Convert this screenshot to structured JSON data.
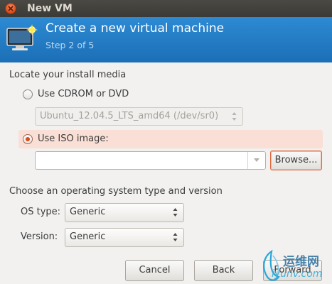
{
  "window": {
    "title": "New VM"
  },
  "header": {
    "title": "Create a new virtual machine",
    "step": "Step 2 of 5"
  },
  "install_media": {
    "heading": "Locate your install media",
    "cdrom_label": "Use CDROM or DVD",
    "cdrom_selected_device": "Ubuntu_12.04.5_LTS_amd64 (/dev/sr0)",
    "iso_label": "Use ISO image:",
    "iso_path": "",
    "browse_label": "Browse...",
    "selected_option": "iso"
  },
  "os": {
    "heading": "Choose an operating system type and version",
    "type_label": "OS type:",
    "type_value": "Generic",
    "version_label": "Version:",
    "version_value": "Generic"
  },
  "footer": {
    "cancel_label": "Cancel",
    "back_label": "Back",
    "forward_label": "Forward"
  },
  "watermark": {
    "text_cn": "运维网",
    "text_url": "iyunv.com"
  },
  "colors": {
    "header_blue": "#1c6fb6",
    "accent_orange": "#df4a16",
    "iso_highlight": "#f9dfd5"
  }
}
